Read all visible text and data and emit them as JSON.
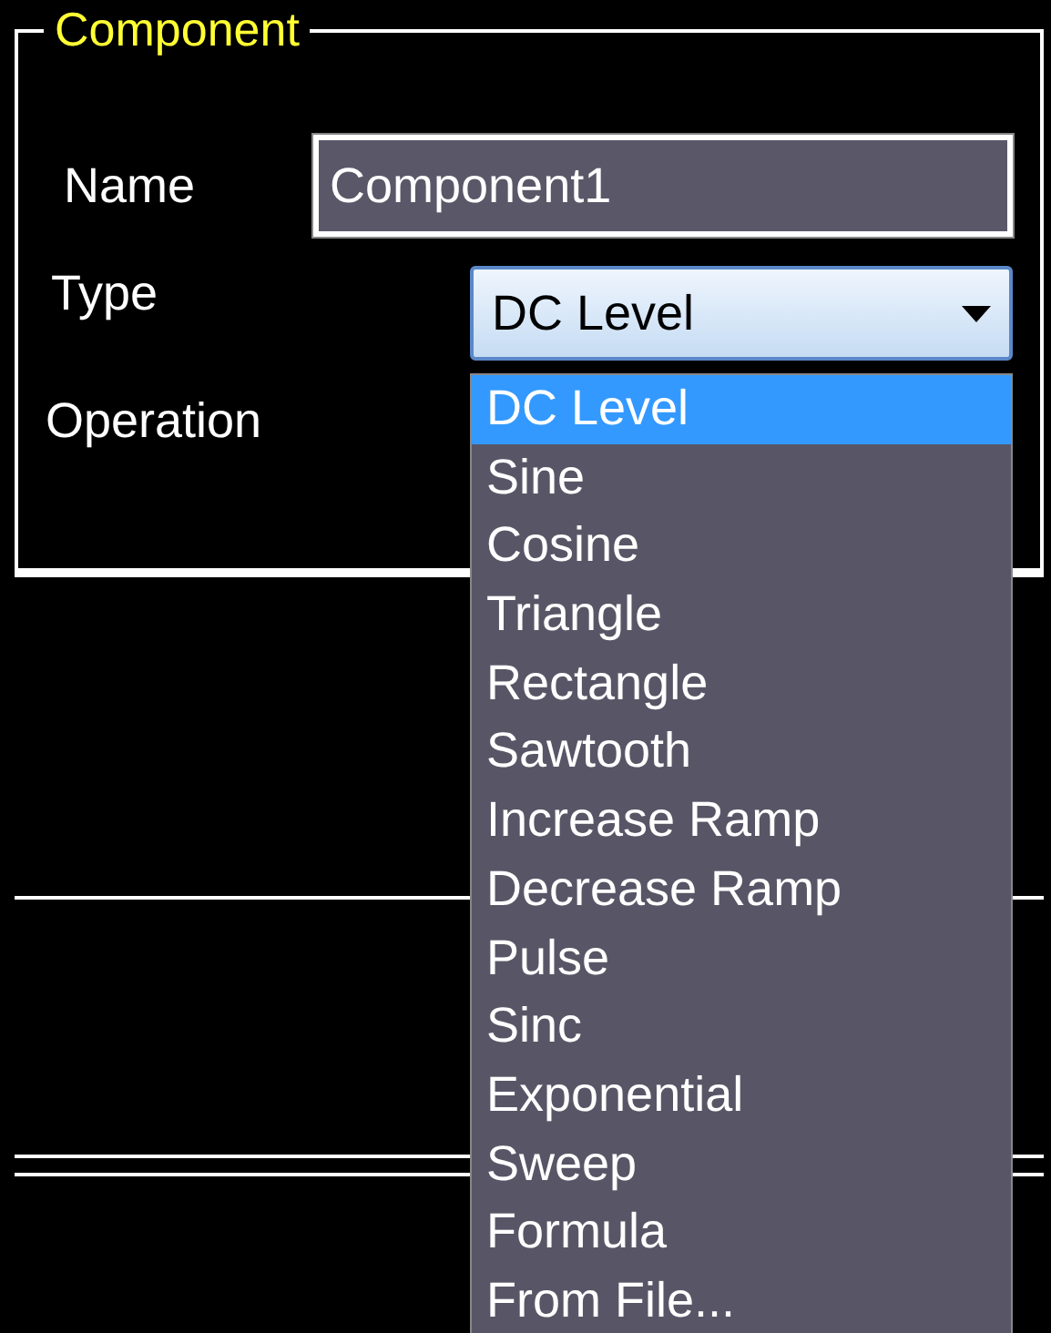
{
  "group": {
    "title": "Component"
  },
  "name_field": {
    "label": "Name",
    "value": "Component1"
  },
  "type_field": {
    "label": "Type",
    "value": "DC Level",
    "expanded": true
  },
  "operation_field": {
    "label": "Operation"
  },
  "type_options": [
    {
      "label": "DC Level",
      "selected": true
    },
    {
      "label": "Sine",
      "selected": false
    },
    {
      "label": "Cosine",
      "selected": false
    },
    {
      "label": "Triangle",
      "selected": false
    },
    {
      "label": "Rectangle",
      "selected": false
    },
    {
      "label": "Sawtooth",
      "selected": false
    },
    {
      "label": "Increase Ramp",
      "selected": false
    },
    {
      "label": "Decrease Ramp",
      "selected": false
    },
    {
      "label": "Pulse",
      "selected": false
    },
    {
      "label": "Sinc",
      "selected": false
    },
    {
      "label": "Exponential",
      "selected": false
    },
    {
      "label": "Sweep",
      "selected": false
    },
    {
      "label": "Formula",
      "selected": false
    },
    {
      "label": "From File...",
      "selected": false
    }
  ]
}
